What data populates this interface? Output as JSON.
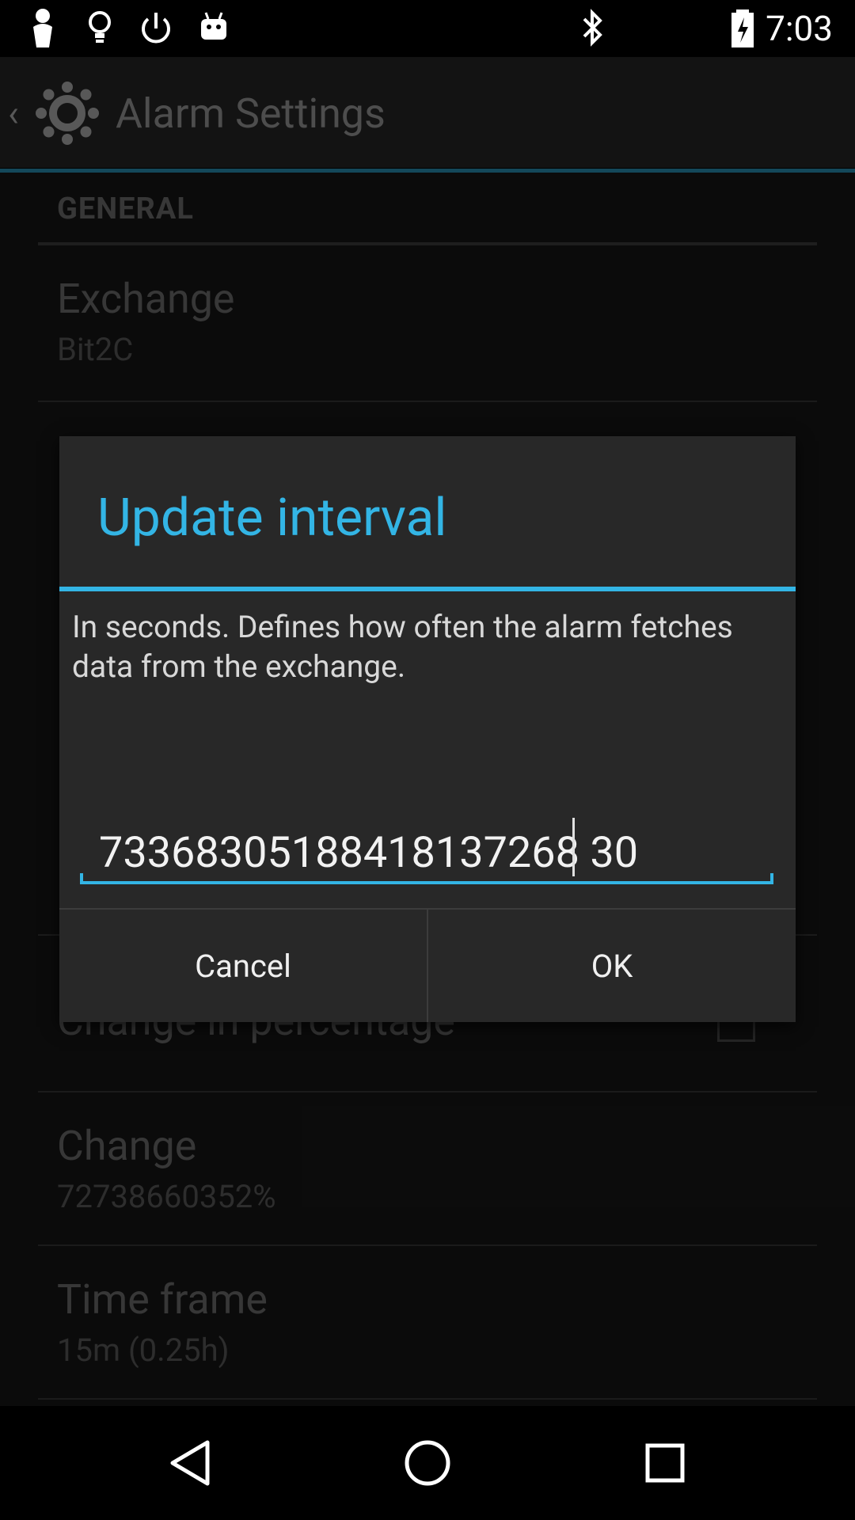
{
  "status_bar": {
    "time": "7:03",
    "icons": [
      "user-pin-icon",
      "lightbulb-icon",
      "power-icon",
      "android-icon",
      "bluetooth-icon",
      "battery-charging-icon"
    ]
  },
  "action_bar": {
    "title": "Alarm Settings",
    "icons": [
      "back-chevron-icon",
      "gear-icon"
    ]
  },
  "settings": {
    "section_header": "GENERAL",
    "items": [
      {
        "title": "Exchange",
        "summary": "Bit2C"
      },
      {
        "title": "Change in percentage",
        "summary": ""
      },
      {
        "title": "Change",
        "summary": "72738660352%"
      },
      {
        "title": "Time frame",
        "summary": "15m (0.25h)"
      }
    ]
  },
  "dialog": {
    "title": "Update interval",
    "message": "In seconds. Defines how often the alarm fetches data from the exchange.",
    "input_value": "73368305188418137268 30",
    "cancel_label": "Cancel",
    "ok_label": "OK"
  },
  "colors": {
    "accent": "#33b5e5",
    "background": "#121212",
    "dialog_background": "#282828"
  },
  "nav_bar": {
    "icons": [
      "back-icon",
      "home-icon",
      "recents-icon"
    ]
  }
}
